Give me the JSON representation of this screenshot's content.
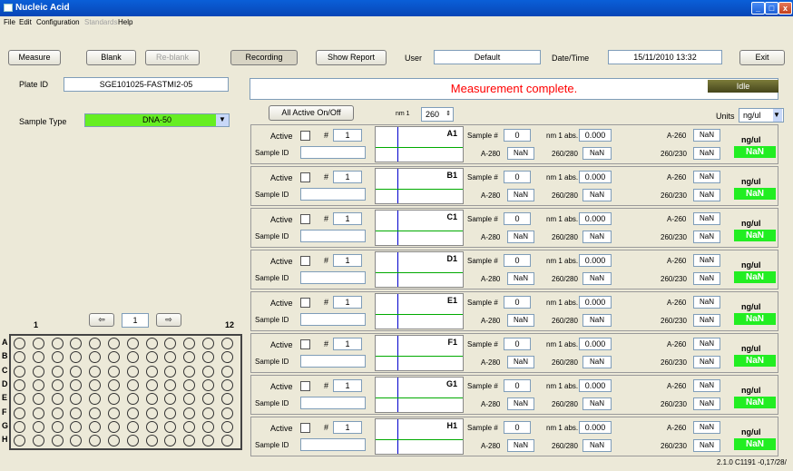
{
  "window": {
    "title": "Nucleic Acid",
    "min": "_",
    "max": "□",
    "close": "x"
  },
  "menu": [
    "File",
    "Edit",
    "Configuration",
    "Standards",
    "Help"
  ],
  "toolbar": {
    "measure": "Measure",
    "blank": "Blank",
    "reblank": "Re-blank",
    "recording": "Recording",
    "show_report": "Show Report",
    "user_label": "User",
    "user_value": "Default",
    "datetime_label": "Date/Time",
    "datetime_value": "15/11/2010 13:32",
    "exit": "Exit"
  },
  "plate_id": {
    "label": "Plate ID",
    "value": "SGE101025-FASTMI2-05"
  },
  "status": {
    "message": "Measurement complete.",
    "state": "Idle"
  },
  "sample_type": {
    "label": "Sample Type",
    "value": "DNA-50",
    "color": "#66ee22"
  },
  "controls": {
    "all_active": "All Active On/Off",
    "nm_label": "nm 1",
    "nm_value": "260",
    "units_label": "Units",
    "units_value": "ng/ul"
  },
  "row_labels": {
    "active": "Active",
    "hash": "#",
    "sample_id": "Sample ID",
    "sample_num": "Sample #",
    "nm1abs": "nm 1 abs.",
    "a280": "A-280",
    "r260_280": "260/280",
    "a260": "A-260",
    "r260_230": "260/230",
    "unit": "ng/ul"
  },
  "wells": [
    {
      "name": "A1",
      "num": "1",
      "sample": "0",
      "abs": "0.000",
      "a280": "NaN",
      "r260_280": "NaN",
      "a260": "NaN",
      "r260_230": "NaN",
      "conc": "NaN"
    },
    {
      "name": "B1",
      "num": "1",
      "sample": "0",
      "abs": "0.000",
      "a280": "NaN",
      "r260_280": "NaN",
      "a260": "NaN",
      "r260_230": "NaN",
      "conc": "NaN"
    },
    {
      "name": "C1",
      "num": "1",
      "sample": "0",
      "abs": "0.000",
      "a280": "NaN",
      "r260_280": "NaN",
      "a260": "NaN",
      "r260_230": "NaN",
      "conc": "NaN"
    },
    {
      "name": "D1",
      "num": "1",
      "sample": "0",
      "abs": "0.000",
      "a280": "NaN",
      "r260_280": "NaN",
      "a260": "NaN",
      "r260_230": "NaN",
      "conc": "NaN"
    },
    {
      "name": "E1",
      "num": "1",
      "sample": "0",
      "abs": "0.000",
      "a280": "NaN",
      "r260_280": "NaN",
      "a260": "NaN",
      "r260_230": "NaN",
      "conc": "NaN"
    },
    {
      "name": "F1",
      "num": "1",
      "sample": "0",
      "abs": "0.000",
      "a280": "NaN",
      "r260_280": "NaN",
      "a260": "NaN",
      "r260_230": "NaN",
      "conc": "NaN"
    },
    {
      "name": "G1",
      "num": "1",
      "sample": "0",
      "abs": "0.000",
      "a280": "NaN",
      "r260_280": "NaN",
      "a260": "NaN",
      "r260_230": "NaN",
      "conc": "NaN"
    },
    {
      "name": "H1",
      "num": "1",
      "sample": "0",
      "abs": "0.000",
      "a280": "NaN",
      "r260_280": "NaN",
      "a260": "NaN",
      "r260_230": "NaN",
      "conc": "NaN"
    }
  ],
  "plate": {
    "col_start": "1",
    "col_end": "12",
    "column_page": "1",
    "prev_icon": "arrow-left-icon",
    "next_icon": "arrow-right-icon",
    "rows": [
      "A",
      "B",
      "C",
      "D",
      "E",
      "F",
      "G",
      "H"
    ]
  },
  "version": "2.1.0 C1191 -0,17/28/"
}
